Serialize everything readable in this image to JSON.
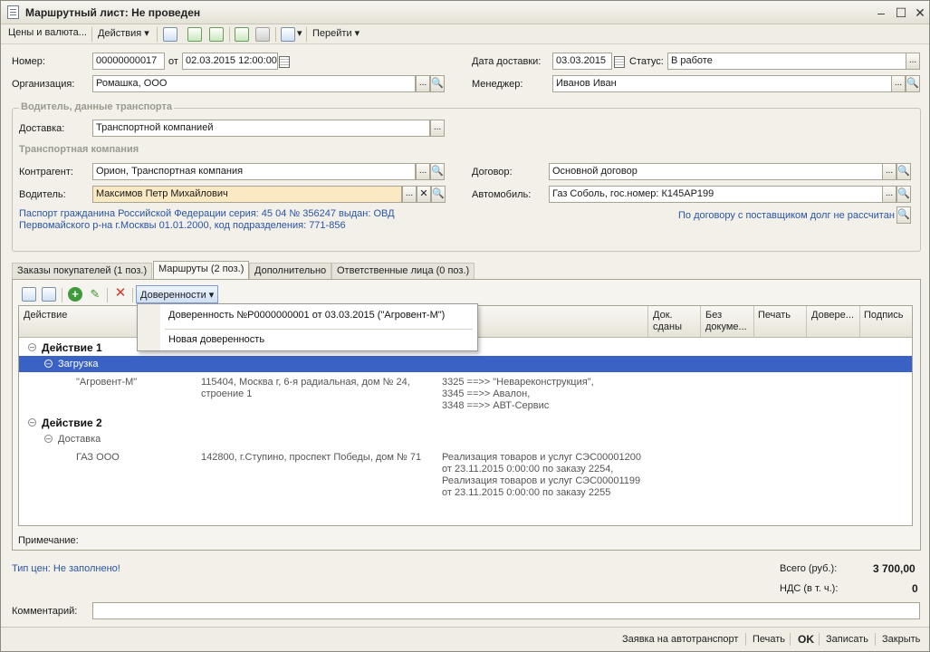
{
  "window": {
    "title": "Маршрутный лист: Не проведен"
  },
  "toolbar": {
    "prices_label": "Цены и валюта...",
    "actions_label": "Действия",
    "goto_label": "Перейти"
  },
  "header": {
    "number_label": "Номер:",
    "number_value": "00000000017",
    "from_label": "от",
    "date_value": "02.03.2015 12:00:00",
    "org_label": "Организация:",
    "org_value": "Ромашка, ООО",
    "delivery_date_label": "Дата доставки:",
    "delivery_date_value": "03.03.2015",
    "status_label": "Статус:",
    "status_value": "В работе",
    "manager_label": "Менеджер:",
    "manager_value": "Иванов Иван"
  },
  "driver_group": {
    "title": "Водитель, данные транспорта",
    "delivery_label": "Доставка:",
    "delivery_value": "Транспортной компанией",
    "transport_company_title": "Транспортная компания",
    "contractor_label": "Контрагент:",
    "contractor_value": "Орион, Транспортная компания",
    "contract_label": "Договор:",
    "contract_value": "Основной договор",
    "driver_label": "Водитель:",
    "driver_value": "Максимов Петр Михайлович",
    "car_label": "Автомобиль:",
    "car_value": "Газ Соболь, гос.номер: К145АР199",
    "passport_line1": "Паспорт гражданина Российской Федерации серия: 45 04 № 356247 выдан: ОВД",
    "passport_line2": "Первомайского р-на г.Москвы 01.01.2000, код подразделения: 771-856",
    "debt_note": "По договору с поставщиком долг не рассчитан"
  },
  "tabs": [
    {
      "label": "Заказы покупателей (1 поз.)"
    },
    {
      "label": "Маршруты (2 поз.)"
    },
    {
      "label": "Дополнительно"
    },
    {
      "label": "Ответственные лица (0 поз.)"
    }
  ],
  "routes": {
    "proxies_button": "Доверенности",
    "columns": {
      "action": "Действие",
      "docs_line1": "Док.",
      "docs_line2": "сданы",
      "nodocs_line1": "Без",
      "nodocs_line2": "докуме...",
      "print": "Печать",
      "proxy": "Довере...",
      "sign": "Подпись"
    },
    "dropdown": {
      "item1": "Доверенность №Р0000000001 от 03.03.2015 (\"Агровент-М\")",
      "item2": "Новая доверенность"
    },
    "action1": {
      "title": "Действие 1",
      "sub": "Загрузка",
      "counterparty": "\"Агровент-М\"",
      "address_line1": "115404, Москва г, 6-я радиальная, дом № 24,",
      "address_line2": "строение 1",
      "orders_line1": "3325 ==>> \"Невареконструкция\",",
      "orders_line2": "3345 ==>> Авалон,",
      "orders_line3": "3348 ==>> АВТ-Сервис"
    },
    "action2": {
      "title": "Действие 2",
      "sub": "Доставка",
      "counterparty": "ГАЗ ООО",
      "address": "142800, г.Ступино, проспект Победы, дом № 71",
      "docs_line1": "Реализация товаров и услуг СЭС00001200",
      "docs_line2": "от 23.11.2015 0:00:00 по заказу 2254,",
      "docs_line3": "Реализация товаров и услуг СЭС00001199",
      "docs_line4": "от 23.11.2015 0:00:00 по заказу 2255"
    },
    "note_label": "Примечание:"
  },
  "totals": {
    "price_type_link": "Тип цен: Не заполнено!",
    "total_label": "Всего (руб.):",
    "total_value": "3 700,00",
    "vat_label": "НДС (в т. ч.):",
    "vat_value": "0"
  },
  "comment": {
    "label": "Комментарий:",
    "value": ""
  },
  "footer": {
    "transport_request": "Заявка на автотранспорт",
    "print": "Печать",
    "ok": "OK",
    "save": "Записать",
    "close": "Закрыть"
  }
}
